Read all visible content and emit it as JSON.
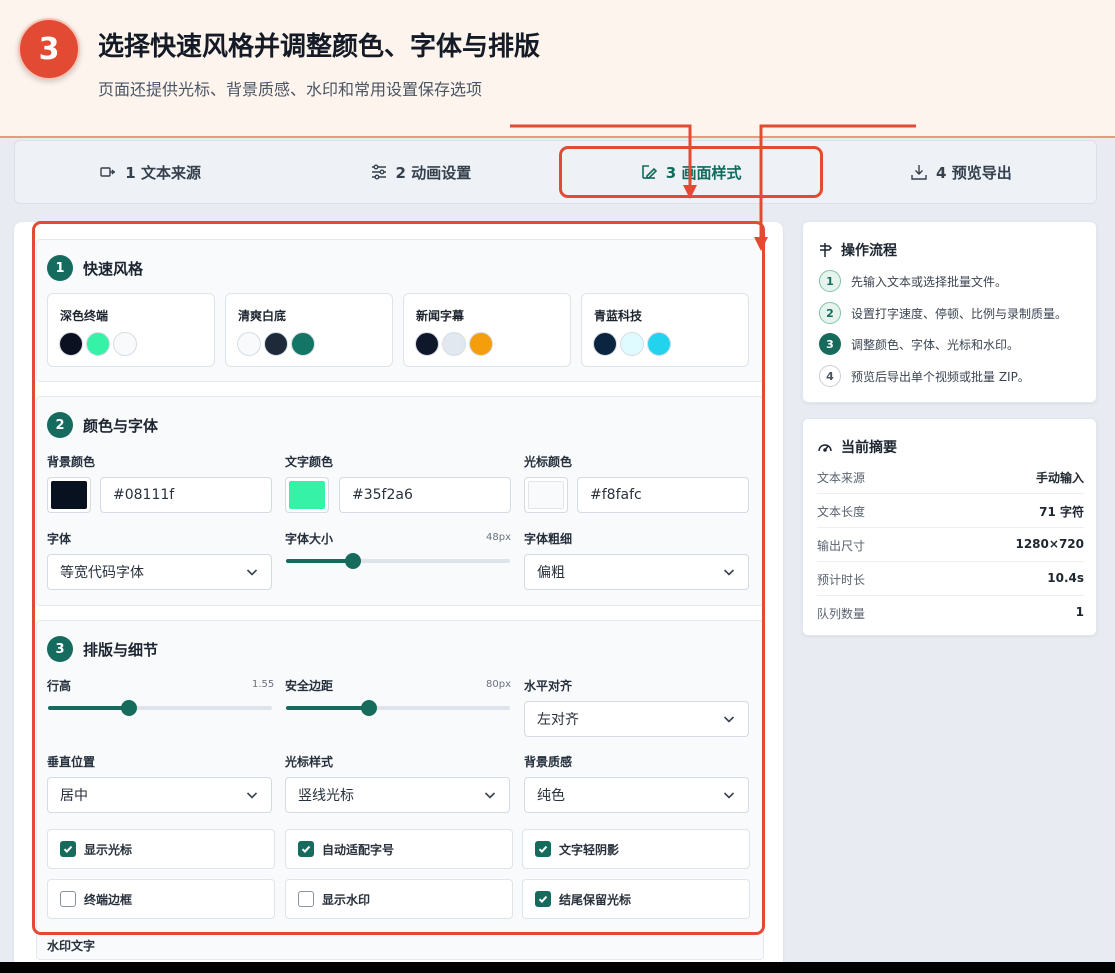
{
  "banner": {
    "step": "3",
    "title": "选择快速风格并调整颜色、字体与排版",
    "subtitle": "页面还提供光标、背景质感、水印和常用设置保存选项"
  },
  "tabs": [
    {
      "label": "1 文本来源",
      "icon": "text-source-icon"
    },
    {
      "label": "2 动画设置",
      "icon": "sliders-icon"
    },
    {
      "label": "3 画面样式",
      "icon": "brush-icon",
      "active": true
    },
    {
      "label": "4 预览导出",
      "icon": "download-icon"
    }
  ],
  "quick_style": {
    "num": "1",
    "title": "快速风格",
    "presets": [
      {
        "name": "深色终端",
        "colors": [
          "#0b1120",
          "#35f2a6",
          "#f8fafc"
        ]
      },
      {
        "name": "清爽白底",
        "colors": [
          "#f8fafc",
          "#1e2a3a",
          "#137566"
        ]
      },
      {
        "name": "新闻字幕",
        "colors": [
          "#0f172a",
          "#e2e8f0",
          "#f59e0b"
        ]
      },
      {
        "name": "青蓝科技",
        "colors": [
          "#0b2540",
          "#dffbff",
          "#22d3ee"
        ]
      }
    ]
  },
  "color_font": {
    "num": "2",
    "title": "颜色与字体",
    "bg_color": {
      "label": "背景颜色",
      "value": "#08111f"
    },
    "text_color": {
      "label": "文字颜色",
      "value": "#35f2a6"
    },
    "cursor_color": {
      "label": "光标颜色",
      "value": "#f8fafc"
    },
    "font": {
      "label": "字体",
      "value": "等宽代码字体"
    },
    "font_size": {
      "label": "字体大小",
      "value": "48px",
      "fraction": 0.3
    },
    "font_weight": {
      "label": "字体粗细",
      "value": "偏粗"
    }
  },
  "layout": {
    "num": "3",
    "title": "排版与细节",
    "line_height": {
      "label": "行高",
      "value": "1.55",
      "fraction": 0.36
    },
    "safe_margin": {
      "label": "安全边距",
      "value": "80px",
      "fraction": 0.37
    },
    "h_align": {
      "label": "水平对齐",
      "value": "左对齐"
    },
    "v_pos": {
      "label": "垂直位置",
      "value": "居中"
    },
    "cursor_style": {
      "label": "光标样式",
      "value": "竖线光标"
    },
    "bg_texture": {
      "label": "背景质感",
      "value": "纯色"
    },
    "checks": [
      {
        "label": "显示光标",
        "checked": true
      },
      {
        "label": "自动适配字号",
        "checked": true
      },
      {
        "label": "文字轻阴影",
        "checked": true
      },
      {
        "label": "终端边框",
        "checked": false
      },
      {
        "label": "显示水印",
        "checked": false
      },
      {
        "label": "结尾保留光标",
        "checked": true
      }
    ],
    "watermark_label": "水印文字"
  },
  "flow": {
    "title": "操作流程",
    "steps": [
      {
        "num": "1",
        "text": "先输入文本或选择批量文件。",
        "state": "done"
      },
      {
        "num": "2",
        "text": "设置打字速度、停顿、比例与录制质量。",
        "state": "done"
      },
      {
        "num": "3",
        "text": "调整颜色、字体、光标和水印。",
        "state": "cur"
      },
      {
        "num": "4",
        "text": "预览后导出单个视频或批量 ZIP。",
        "state": "todo"
      }
    ]
  },
  "summary": {
    "title": "当前摘要",
    "rows": [
      {
        "k": "文本来源",
        "v": "手动输入"
      },
      {
        "k": "文本长度",
        "v": "71 字符"
      },
      {
        "k": "输出尺寸",
        "v": "1280×720"
      },
      {
        "k": "预计时长",
        "v": "10.4s"
      },
      {
        "k": "队列数量",
        "v": "1"
      }
    ]
  },
  "colors": {
    "accent": "#166b5d",
    "annotation": "#e24a33"
  }
}
